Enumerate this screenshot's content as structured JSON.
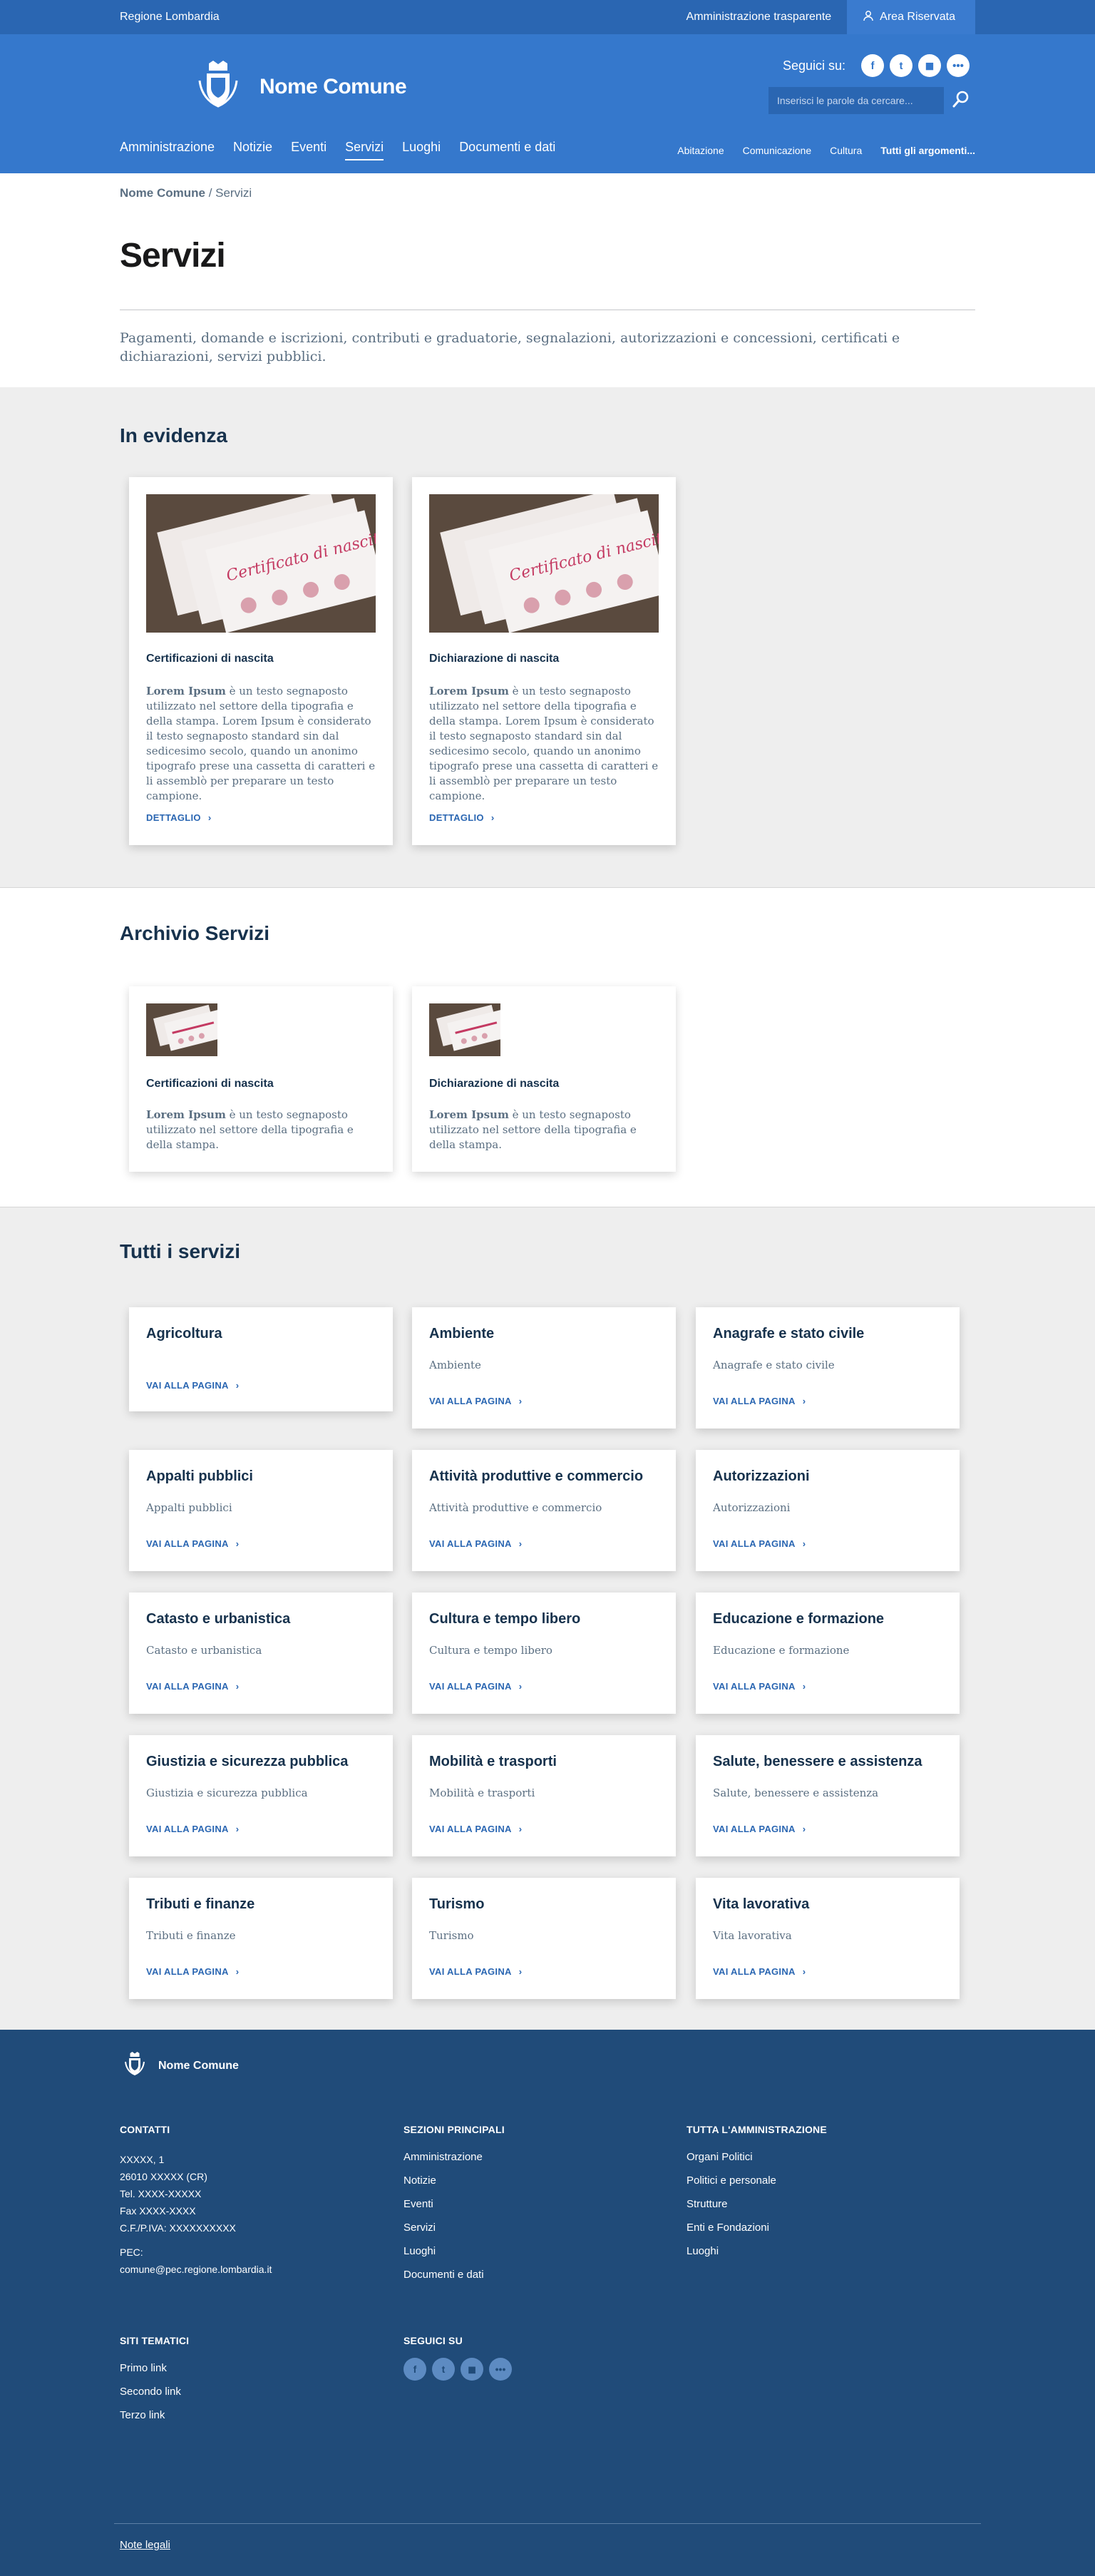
{
  "slim": {
    "region": "Regione Lombardia",
    "transparency": "Amministrazione trasparente",
    "reserved": "Area Riservata"
  },
  "header": {
    "brand": "Nome Comune",
    "follow": "Seguici su:",
    "social": [
      "f",
      "t",
      "◼",
      "•••"
    ],
    "search_placeholder": "Inserisci le parole da cercare..."
  },
  "nav": {
    "main": [
      "Amministrazione",
      "Notizie",
      "Eventi",
      "Servizi",
      "Luoghi",
      "Documenti e dati"
    ],
    "active": "Servizi",
    "secondary": [
      "Abitazione",
      "Comunicazione",
      "Cultura",
      "Tutti gli argomenti..."
    ]
  },
  "breadcrumb": {
    "home": "Nome Comune",
    "sep": " / ",
    "current": "Servizi"
  },
  "page": {
    "title": "Servizi",
    "lead": "Pagamenti, domande e iscrizioni, contributi e graduatorie, segnalazioni, autorizzazioni e concessioni, certificati e dichiarazioni, servizi pubblici."
  },
  "evidenza": {
    "title": "In evidenza",
    "cards": [
      {
        "title": "Certificazioni di nascita",
        "bold": "Lorem Ipsum",
        "text": " è un testo segnaposto utilizzato nel settore della tipografia e della stampa. Lorem Ipsum è considerato il testo segnaposto standard sin dal sedicesimo secolo, quando un anonimo tipografo prese una cassetta di caratteri e li assemblò per preparare un testo campione.",
        "link": "DETTAGLIO"
      },
      {
        "title": "Dichiarazione di nascita",
        "bold": "Lorem Ipsum",
        "text": " è un testo segnaposto utilizzato nel settore della tipografia e della stampa. Lorem Ipsum è considerato il testo segnaposto standard sin dal sedicesimo secolo, quando un anonimo tipografo prese una cassetta di caratteri e li assemblò per preparare un testo campione.",
        "link": "DETTAGLIO"
      }
    ]
  },
  "archivio": {
    "title": "Archivio Servizi",
    "cards": [
      {
        "title": "Certificazioni di nascita",
        "bold": "Lorem Ipsum",
        "text": " è un testo segnaposto utilizzato nel settore della tipografia e della stampa."
      },
      {
        "title": "Dichiarazione di nascita",
        "bold": "Lorem Ipsum",
        "text": " è un testo segnaposto utilizzato nel settore della tipografia e della stampa."
      }
    ]
  },
  "tutti": {
    "title": "Tutti i servizi",
    "link": "VAI ALLA PAGINA",
    "items": [
      {
        "title": "Agricoltura",
        "desc": ""
      },
      {
        "title": "Ambiente",
        "desc": "Ambiente"
      },
      {
        "title": "Anagrafe e stato civile",
        "desc": "Anagrafe e stato civile"
      },
      {
        "title": "Appalti pubblici",
        "desc": "Appalti pubblici"
      },
      {
        "title": "Attività produttive e commercio",
        "desc": "Attività produttive e commercio"
      },
      {
        "title": "Autorizzazioni",
        "desc": "Autorizzazioni"
      },
      {
        "title": "Catasto e urbanistica",
        "desc": "Catasto e urbanistica"
      },
      {
        "title": "Cultura e tempo libero",
        "desc": "Cultura e tempo libero"
      },
      {
        "title": "Educazione e formazione",
        "desc": "Educazione e formazione"
      },
      {
        "title": "Giustizia e sicurezza pubblica",
        "desc": "Giustizia e sicurezza pubblica"
      },
      {
        "title": "Mobilità e trasporti",
        "desc": "Mobilità e trasporti"
      },
      {
        "title": "Salute, benessere e assistenza",
        "desc": "Salute, benessere e assistenza"
      },
      {
        "title": "Tributi e finanze",
        "desc": "Tributi e finanze"
      },
      {
        "title": "Turismo",
        "desc": "Turismo"
      },
      {
        "title": "Vita lavorativa",
        "desc": "Vita lavorativa"
      }
    ]
  },
  "footer": {
    "brand": "Nome Comune",
    "contatti": {
      "title": "CONTATTI",
      "lines": [
        "XXXXX, 1",
        "26010 XXXXX (CR)",
        "Tel. XXXX-XXXXX",
        "Fax XXXX-XXXX",
        "C.F./P.IVA: XXXXXXXXXX"
      ],
      "pec_label": "PEC:",
      "pec": "comune@pec.regione.lombardia.it"
    },
    "sezioni": {
      "title": "SEZIONI PRINCIPALI",
      "links": [
        "Amministrazione",
        "Notizie",
        "Eventi",
        "Servizi",
        "Luoghi",
        "Documenti e dati"
      ]
    },
    "amministrazione": {
      "title": "TUTTA L'AMMINISTRAZIONE",
      "links": [
        "Organi Politici",
        "Politici e personale",
        "Strutture",
        "Enti e Fondazioni",
        "Luoghi"
      ]
    },
    "siti": {
      "title": "SITI TEMATICI",
      "links": [
        "Primo link",
        "Secondo link",
        "Terzo link"
      ]
    },
    "seguici": {
      "title": "SEGUICI SU",
      "icons": [
        "f",
        "t",
        "◼",
        "•••"
      ]
    },
    "legal": "Note legali"
  },
  "colors": {
    "primary": "#3578cc",
    "slim": "#2a66b2",
    "footer": "#204b79",
    "title": "#17324d",
    "grey_bg": "#eeeeee"
  }
}
